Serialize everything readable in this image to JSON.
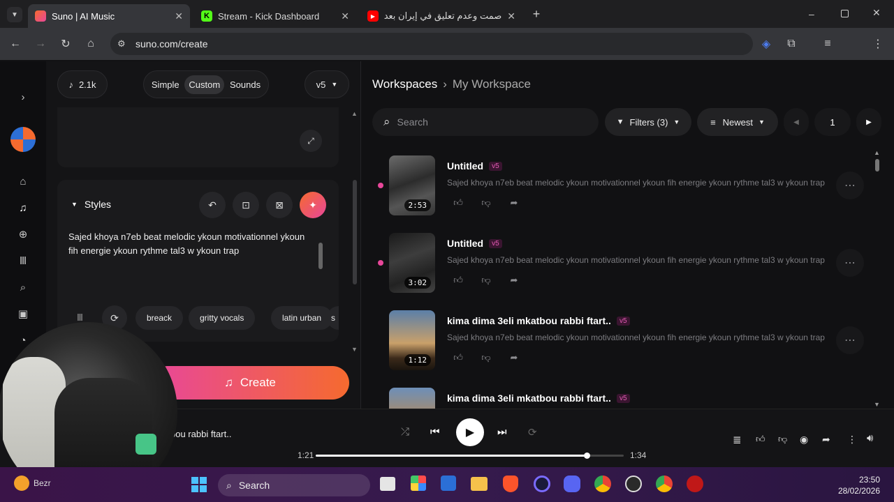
{
  "browser": {
    "tabs": [
      {
        "title": "Suno | AI Music",
        "active": true
      },
      {
        "title": "Stream - Kick Dashboard",
        "active": false
      },
      {
        "title": "صمت وعدم تعليق في إيران بعد...",
        "active": false
      }
    ],
    "url": "suno.com/create"
  },
  "left": {
    "credits": "2.1k",
    "modes": [
      "Simple",
      "Custom",
      "Sounds"
    ],
    "active_mode": "Custom",
    "version": "v5",
    "styles_label": "Styles",
    "styles_text": "Sajed khoya n7eb beat melodic  ykoun motivationnel ykoun fih energie ykoun rythme tal3 w ykoun trap",
    "tags": [
      "breack",
      "gritty vocals",
      "latin urban",
      "s"
    ],
    "create_label": "Create"
  },
  "right": {
    "breadcrumb_root": "Workspaces",
    "breadcrumb_current": "My Workspace",
    "search_placeholder": "Search",
    "filters_label": "Filters (3)",
    "sort_label": "Newest",
    "page": "1",
    "songs": [
      {
        "title": "Untitled",
        "version": "v5",
        "desc": "Sajed khoya n7eb beat melodic ykoun motivationnel ykoun fih energie ykoun rythme tal3 w ykoun trap",
        "duration": "2:53"
      },
      {
        "title": "Untitled",
        "version": "v5",
        "desc": "Sajed khoya n7eb beat melodic ykoun motivationnel ykoun fih energie ykoun rythme tal3 w ykoun trap",
        "duration": "3:02"
      },
      {
        "title": "kima dima 3eli mkatbou rabbi ftart..",
        "version": "v5",
        "desc": "Sajed khoya n7eb beat melodic ykoun motivationnel ykoun fih energie ykoun rythme tal3 w ykoun trap",
        "duration": "1:12"
      },
      {
        "title": "kima dima 3eli mkatbou rabbi ftart..",
        "version": "v5",
        "desc": "",
        "duration": ""
      }
    ]
  },
  "player": {
    "track_title": "bou rabbi ftart..",
    "elapsed": "1:21",
    "total": "1:34",
    "progress_fraction": 0.88
  },
  "taskbar": {
    "search_label": "Search",
    "weather_label": "Bezr",
    "time": "23:50",
    "date": "28/02/2026"
  },
  "colors": {
    "accent_pink": "#e8479a",
    "accent_orange": "#f56a2f",
    "bg": "#111113"
  }
}
